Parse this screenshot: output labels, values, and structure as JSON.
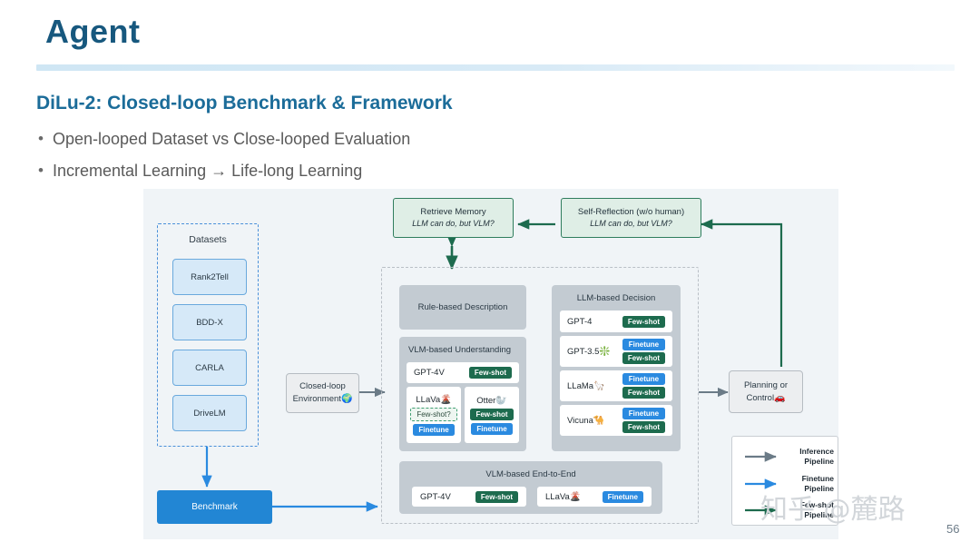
{
  "slide": {
    "title": "Agent",
    "subtitle": "DiLu-2: Closed-loop Benchmark & Framework",
    "bullets": [
      "Open-looped Dataset vs Close-looped Evaluation",
      "Incremental Learning → Life-long Learning"
    ],
    "bullet_marker": "•",
    "page_number": "56",
    "watermark": "知乎 @麓路"
  },
  "colors": {
    "title": "#17587e",
    "subtitle": "#1b6c99",
    "bullet_text": "#5a5a5a",
    "figure_bg": "#f0f4f7",
    "dataset_fill": "#d6e9f8",
    "dataset_border": "#6aa9dd",
    "benchmark_fill": "#2286d4",
    "panel_fill": "#c3cbd2",
    "green_fill": "#dfeee6",
    "green_border": "#2f7d5d",
    "badge_fewshot": "#1d6b4e",
    "badge_finetune": "#2a8ae0",
    "arrow_inference": "#6b7b87",
    "arrow_finetune": "#2a8ae0",
    "arrow_fewshot": "#1d6b4e"
  },
  "figure": {
    "datasets_group": {
      "label": "Datasets",
      "items": [
        "Rank2Tell",
        "BDD-X",
        "CARLA",
        "DriveLM"
      ]
    },
    "benchmark": {
      "label": "Benchmark"
    },
    "environment": {
      "line1": "Closed-loop",
      "line2": "Environment",
      "emoji": "🌍"
    },
    "memory": {
      "line1": "Retrieve Memory",
      "line2": "LLM can do, but VLM?"
    },
    "reflection": {
      "line1": "Self-Reflection (w/o human)",
      "line2": "LLM can do, but VLM?"
    },
    "planning": {
      "line1": "Planning or",
      "line2": "Control",
      "emoji": "🚗"
    },
    "rule_based": {
      "title": "Rule-based Description"
    },
    "vlm_understanding": {
      "title": "VLM-based Understanding",
      "top_card": {
        "name": "GPT-4V",
        "badges": [
          "Few-shot"
        ]
      },
      "cards": [
        {
          "name": "LLaVa",
          "emoji": "🌋",
          "badges": [
            "Few-shot?",
            "Finetune"
          ]
        },
        {
          "name": "Otter",
          "emoji": "🦭",
          "badges": [
            "Few-shot",
            "Finetune"
          ]
        }
      ]
    },
    "llm_decision": {
      "title": "LLM-based Decision",
      "cards": [
        {
          "name": "GPT-4",
          "emoji": "",
          "badges": [
            "Few-shot"
          ]
        },
        {
          "name": "GPT-3.5",
          "emoji": "❇️",
          "badges": [
            "Finetune",
            "Few-shot"
          ]
        },
        {
          "name": "LLaMa",
          "emoji": "🦙",
          "badges": [
            "Finetune",
            "Few-shot"
          ]
        },
        {
          "name": "Vicuna",
          "emoji": "🐪",
          "badges": [
            "Finetune",
            "Few-shot"
          ]
        }
      ]
    },
    "vlm_end_to_end": {
      "title": "VLM-based End-to-End",
      "cards": [
        {
          "name": "GPT-4V",
          "emoji": "",
          "badges": [
            "Few-shot"
          ]
        },
        {
          "name": "LLaVa",
          "emoji": "🌋",
          "badges": [
            "Finetune"
          ]
        }
      ]
    },
    "legend": {
      "items": [
        {
          "line1": "Inference",
          "line2": "Pipeline",
          "color": "#6b7b87"
        },
        {
          "line1": "Finetune",
          "line2": "Pipeline",
          "color": "#2a8ae0"
        },
        {
          "line1": "Few-shot",
          "line2": "Pipeline",
          "color": "#1d6b4e"
        }
      ]
    }
  }
}
